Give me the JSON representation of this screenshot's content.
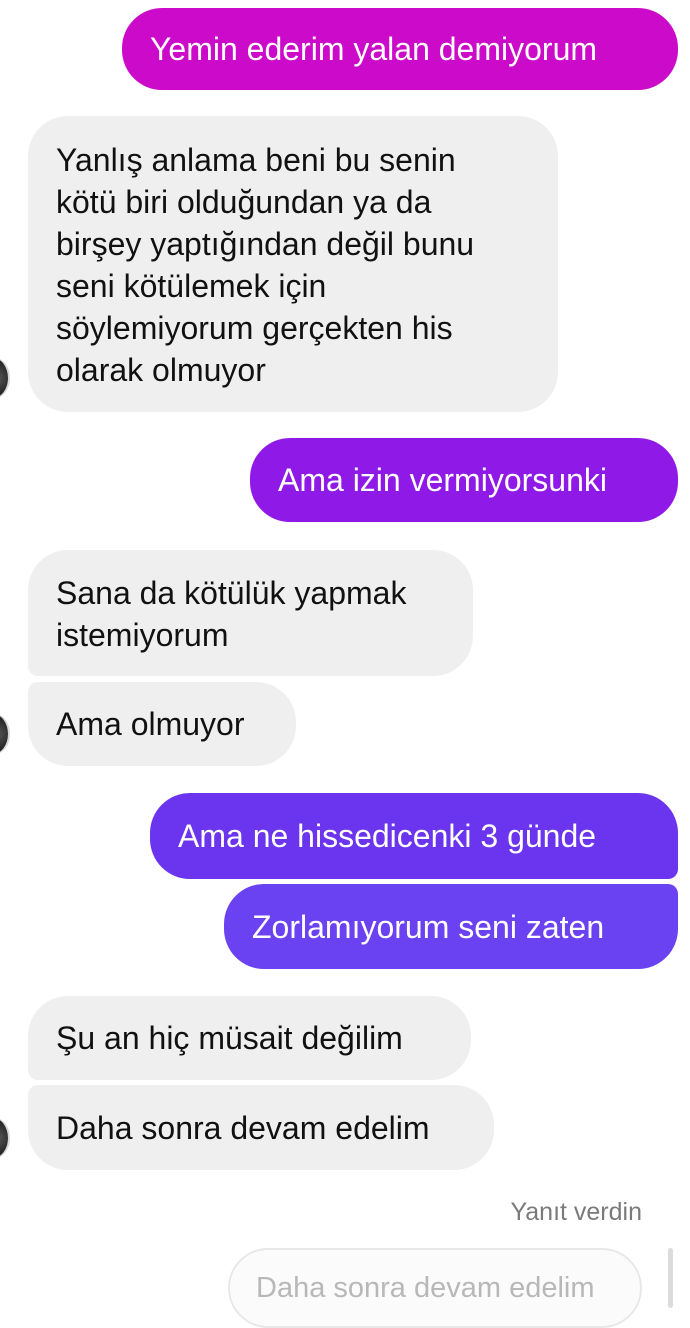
{
  "messages": [
    {
      "id": "m1",
      "direction": "outgoing",
      "text": "Yemin ederim yalan demiyorum",
      "color": "#cc0ac9"
    },
    {
      "id": "m2",
      "direction": "incoming",
      "lines": [
        "Yanlış anlama beni bu senin",
        "kötü biri olduğundan ya da",
        "birşey yaptığından değil bunu",
        "seni kötülemek için",
        "söylemiyorum gerçekten his",
        "olarak olmuyor"
      ]
    },
    {
      "id": "m3",
      "direction": "outgoing",
      "text": "Ama izin vermiyorsunki",
      "color": "#8f1ae8"
    },
    {
      "id": "m4",
      "direction": "incoming",
      "lines": [
        "Sana da kötülük yapmak",
        "istemiyorum"
      ]
    },
    {
      "id": "m5",
      "direction": "incoming",
      "text": "Ama olmuyor"
    },
    {
      "id": "m6",
      "direction": "outgoing",
      "text": "Ama ne hissedicenki 3 günde",
      "color": "#6b35ef"
    },
    {
      "id": "m7",
      "direction": "outgoing",
      "text": "Zorlamıyorum seni zaten",
      "color": "#6b42f1"
    },
    {
      "id": "m8",
      "direction": "incoming",
      "text": "Şu an hiç müsait değilim"
    },
    {
      "id": "m9",
      "direction": "incoming",
      "text": "Daha sonra devam edelim"
    }
  ],
  "reply": {
    "status_label": "Yanıt verdin",
    "quoted_text": "Daha sonra devam edelim"
  },
  "icons": {
    "contact_avatar": "avatar-icon"
  }
}
